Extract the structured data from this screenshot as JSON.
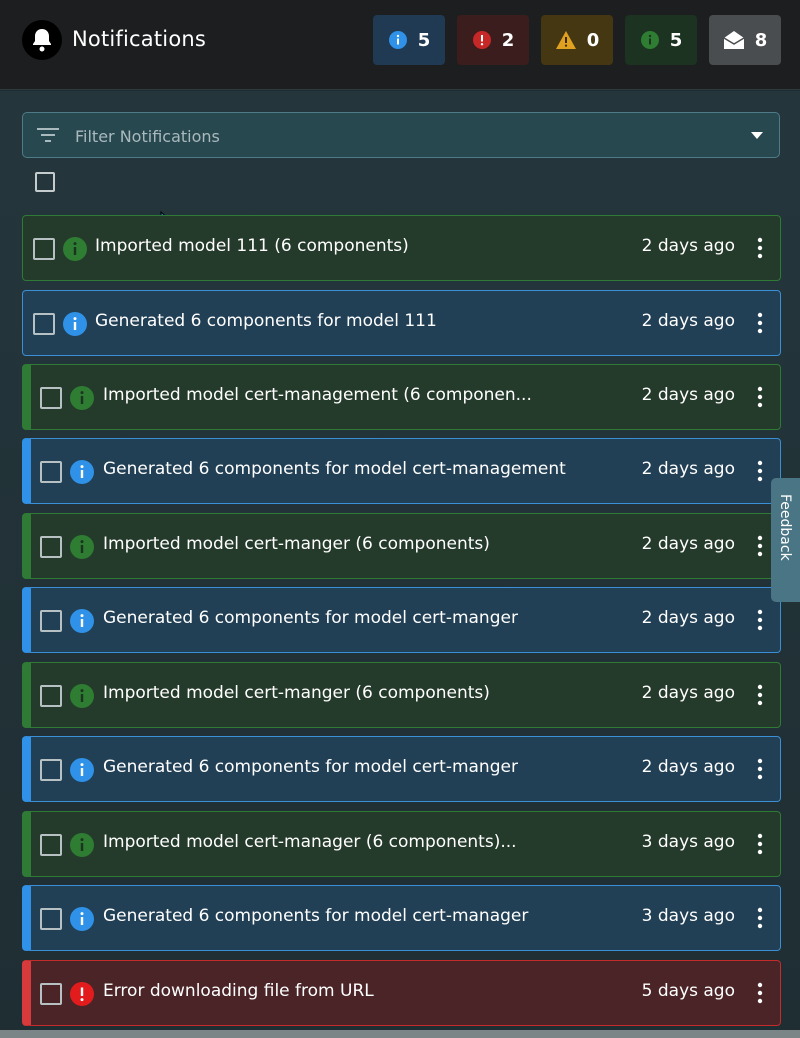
{
  "header": {
    "title": "Notifications",
    "counters": [
      {
        "type": "info",
        "count": "5"
      },
      {
        "type": "error",
        "count": "2"
      },
      {
        "type": "warning",
        "count": "0"
      },
      {
        "type": "success",
        "count": "5"
      },
      {
        "type": "read",
        "count": "8"
      }
    ]
  },
  "filter": {
    "placeholder": "Filter Notifications"
  },
  "notifications": [
    {
      "severity": "success",
      "message": "Imported model 111 (6 components)",
      "time": "2 days ago"
    },
    {
      "severity": "info",
      "message": "Generated 6 components for model 111",
      "time": "2 days ago"
    },
    {
      "severity": "success",
      "message": "Imported model cert-management (6 componen...",
      "time": "2 days ago"
    },
    {
      "severity": "info",
      "message": "Generated 6 components for model cert-management",
      "time": "2 days ago"
    },
    {
      "severity": "success",
      "message": "Imported model cert-manger (6 components)",
      "time": "2 days ago"
    },
    {
      "severity": "info",
      "message": "Generated 6 components for model cert-manger",
      "time": "2 days ago"
    },
    {
      "severity": "success",
      "message": "Imported model cert-manger (6 components)",
      "time": "2 days ago"
    },
    {
      "severity": "info",
      "message": "Generated 6 components for model cert-manger",
      "time": "2 days ago"
    },
    {
      "severity": "success",
      "message": "Imported model cert-manager (6 components)...",
      "time": "3 days ago"
    },
    {
      "severity": "info",
      "message": "Generated 6 components for model cert-manager",
      "time": "3 days ago"
    },
    {
      "severity": "error",
      "message": "Error downloading file from URL",
      "time": "5 days ago"
    }
  ],
  "feedback": {
    "label": "Feedback"
  },
  "colors": {
    "info": "#2f92e8",
    "error": "#d63a3a",
    "warning": "#e0a020",
    "success": "#2f7a35"
  },
  "icons": {
    "header": "bell-icon",
    "info": "info-icon",
    "error": "error-icon",
    "warning": "warning-icon",
    "success": "success-icon",
    "read": "envelope-open-icon",
    "filter": "filter-icon",
    "caret": "chevron-down-icon",
    "more": "more-vert-icon"
  }
}
